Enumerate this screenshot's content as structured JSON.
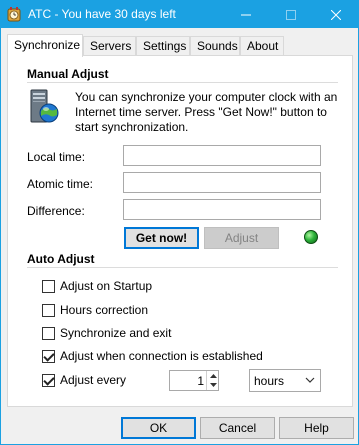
{
  "window": {
    "title": "ATC - You have 30 days left",
    "accent": "#1ba1e2"
  },
  "titlebar_buttons": {
    "minimize_icon": "minimize-icon",
    "maximize_icon": "maximize-icon",
    "close_icon": "close-icon"
  },
  "tabs": [
    {
      "label": "Synchronize",
      "active": true
    },
    {
      "label": "Servers",
      "active": false
    },
    {
      "label": "Settings",
      "active": false
    },
    {
      "label": "Sounds",
      "active": false
    },
    {
      "label": "About",
      "active": false
    }
  ],
  "manual_adjust": {
    "title": "Manual Adjust",
    "info_text": "You can synchronize your computer clock with an Internet time server. Press \"Get Now!\" button to start synchronization.",
    "fields": [
      {
        "label": "Local time:",
        "value": ""
      },
      {
        "label": "Atomic time:",
        "value": ""
      },
      {
        "label": "Difference:",
        "value": ""
      }
    ],
    "get_now_label": "Get now!",
    "adjust_label": "Adjust",
    "status_color": "#2db33a"
  },
  "auto_adjust": {
    "title": "Auto Adjust",
    "options": [
      {
        "label": "Adjust on Startup",
        "checked": false
      },
      {
        "label": "Hours correction",
        "checked": false
      },
      {
        "label": "Synchronize and exit",
        "checked": false
      },
      {
        "label": "Adjust when connection is established",
        "checked": true
      },
      {
        "label": "Adjust every",
        "checked": true
      }
    ],
    "interval_value": "1",
    "interval_unit": "hours"
  },
  "footer": {
    "ok_label": "OK",
    "cancel_label": "Cancel",
    "help_label": "Help"
  }
}
